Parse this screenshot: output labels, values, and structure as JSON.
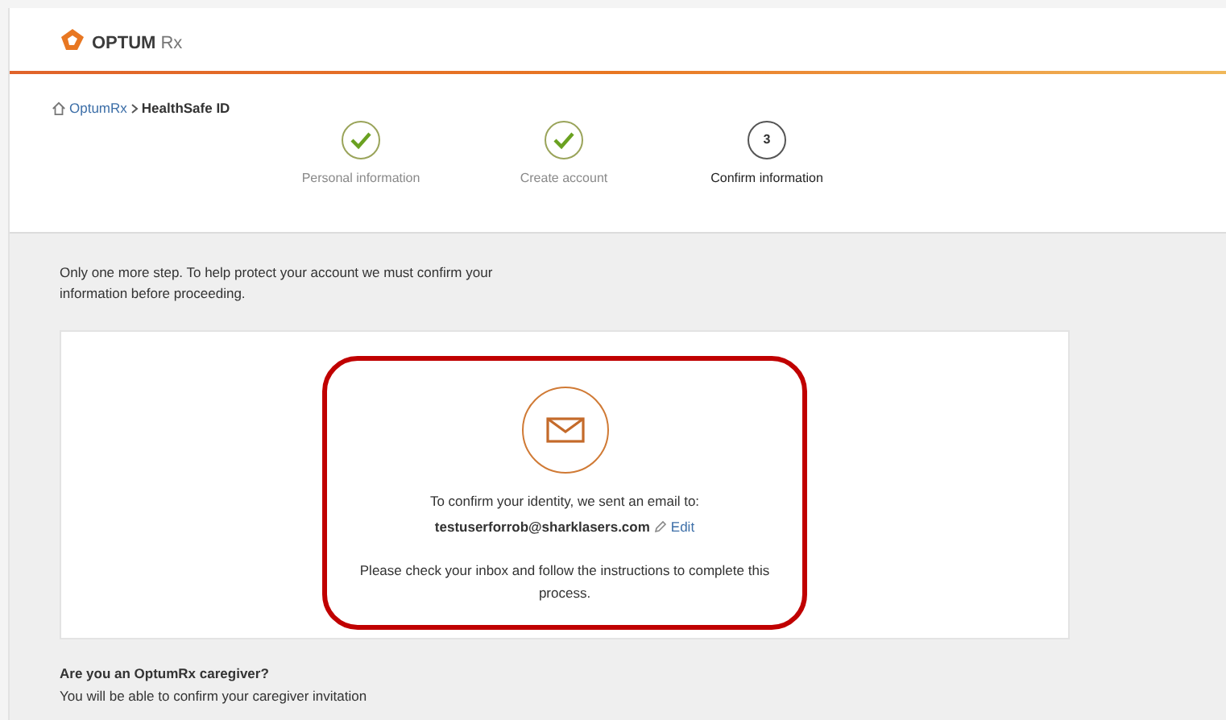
{
  "header": {
    "logo_text": "OPTUM",
    "logo_suffix": "Rx"
  },
  "breadcrumb": [
    {
      "label": "OptumRx",
      "kind": "link"
    },
    {
      "label": "HealthSafe ID",
      "kind": "current"
    }
  ],
  "steps": [
    {
      "label": "Personal information",
      "completed": true,
      "selected": false
    },
    {
      "label": "Create account",
      "completed": true,
      "selected": false
    },
    {
      "label": "Confirm information",
      "number": "3",
      "completed": false,
      "selected": true
    }
  ],
  "intro": "Only one more step. To help protect your account we must confirm your information before proceeding.",
  "card": {
    "message": "To confirm your identity, we sent an email to:",
    "email": "testuserforrob@sharklasers.com",
    "edit_label": "Edit",
    "instructions": "Please check your inbox and follow the instructions to complete this process.",
    "highlighted": true
  },
  "caregiver": {
    "title": "Are you an OptumRx caregiver?",
    "text": "You will be able to confirm your caregiver invitation"
  }
}
